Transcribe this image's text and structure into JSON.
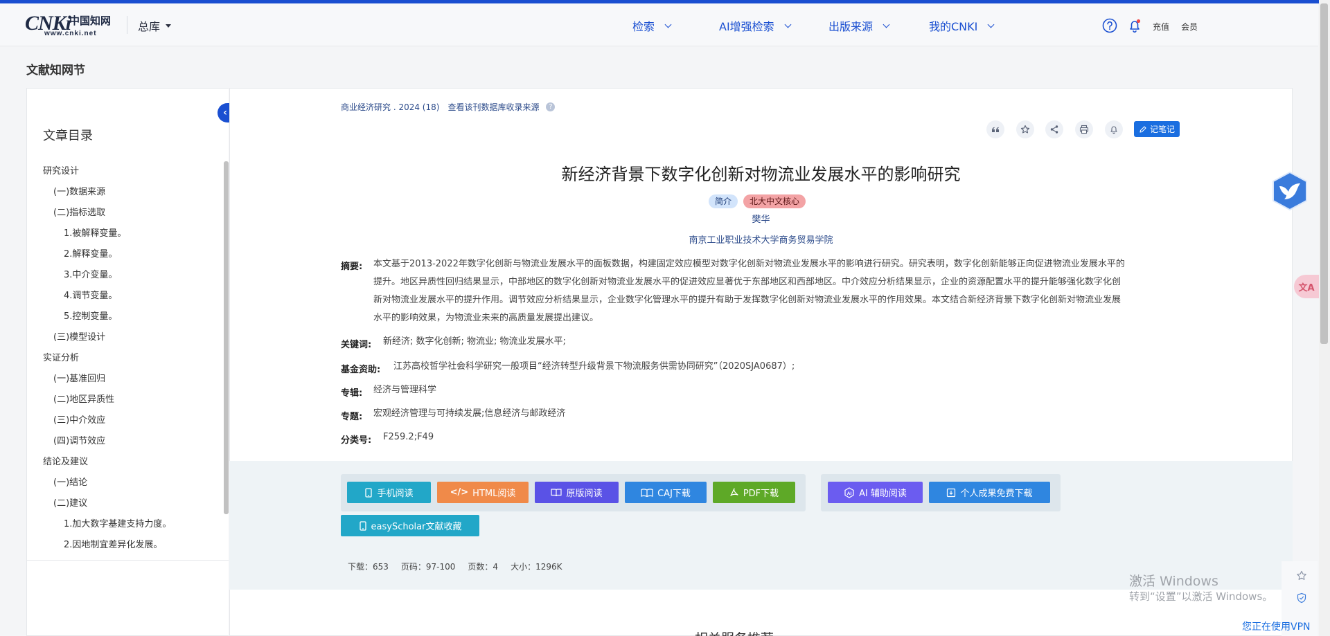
{
  "header": {
    "logo_mark": "CNKi",
    "logo_cn": "中国知网",
    "logo_url": "www.cnki.net",
    "database": "总库",
    "nav": [
      "检索",
      "AI增强检索",
      "出版来源",
      "我的CNKI"
    ],
    "recharge": "充值",
    "member": "会员"
  },
  "section_title": "文献知网节",
  "toc": {
    "title": "文章目录",
    "items": [
      {
        "text": "研究设计",
        "level": 0
      },
      {
        "text": "(一)数据来源",
        "level": 1
      },
      {
        "text": "(二)指标选取",
        "level": 1
      },
      {
        "text": "1.被解释变量。",
        "level": 2
      },
      {
        "text": "2.解释变量。",
        "level": 2
      },
      {
        "text": "3.中介变量。",
        "level": 2
      },
      {
        "text": "4.调节变量。",
        "level": 2
      },
      {
        "text": "5.控制变量。",
        "level": 2
      },
      {
        "text": "(三)模型设计",
        "level": 1
      },
      {
        "text": "实证分析",
        "level": 0
      },
      {
        "text": "(一)基准回归",
        "level": 1
      },
      {
        "text": "(二)地区异质性",
        "level": 1
      },
      {
        "text": "(三)中介效应",
        "level": 1
      },
      {
        "text": "(四)调节效应",
        "level": 1
      },
      {
        "text": "结论及建议",
        "level": 0
      },
      {
        "text": "(一)结论",
        "level": 1
      },
      {
        "text": "(二)建议",
        "level": 1
      },
      {
        "text": "1.加大数字基建支持力度。",
        "level": 2
      },
      {
        "text": "2.因地制宜差异化发展。",
        "level": 2
      }
    ]
  },
  "article": {
    "source": "商业经济研究 . 2024 (18)",
    "source_link": "查看该刊数据库收录来源",
    "note_button": "记笔记",
    "title": "新经济背景下数字化创新对物流业发展水平的影响研究",
    "badges": [
      "简介",
      "北大中文核心"
    ],
    "author": "樊华",
    "institution": "南京工业职业技术大学商务贸易学院",
    "abstract_label": "摘要:",
    "abstract_lines": [
      "本文基于2013-2022年数字化创新与物流业发展水平的面板数据，构建固定效应模型对数字化创新对物流业发展水平的影响进行研究。研究表明，数字化创新能够正向促进物流业发展水平的",
      "提升。地区异质性回归结果显示，中部地区的数字化创新对物流业发展水平的促进效应显著优于东部地区和西部地区。中介效应分析结果显示，企业的资源配置水平的提升能够强化数字化创",
      "新对物流业发展水平的提升作用。调节效应分析结果显示，企业数字化管理水平的提升有助于发挥数字化创新对物流业发展水平的作用效果。本文结合新经济背景下数字化创新对物流业发展",
      "水平的影响效果，为物流业未来的高质量发展提出建议。"
    ],
    "keywords_label": "关键词:",
    "keywords": "新经济;  数字化创新;  物流业;  物流业发展水平;",
    "fund_label": "基金资助:",
    "fund": "江苏高校哲学社会科学研究一般项目“经济转型升级背景下物流服务供需协同研究”（2020SJA0687）;",
    "album_label": "专辑:",
    "album": "经济与管理科学",
    "topic_label": "专题:",
    "topic": "宏观经济管理与可持续发展;信息经济与邮政经济",
    "class_label": "分类号:",
    "class": "F259.2;F49"
  },
  "actions": {
    "mobile": "手机阅读",
    "html": "HTML阅读",
    "original": "原版阅读",
    "caj": "CAJ下载",
    "pdf": "PDF下载",
    "ai": "AI 辅助阅读",
    "personal": "个人成果免费下载",
    "easyscholar": "easyScholar文献收藏"
  },
  "stats": {
    "downloads": "下载：653",
    "pages": "页码：97-100",
    "page_count": "页数：4",
    "size": "大小：1296K"
  },
  "colors": {
    "mobile": "#22a7c8",
    "html": "#f08a49",
    "original": "#5a52e6",
    "caj": "#2f86e0",
    "pdf": "#5ea927",
    "ai": "#6b5cf0",
    "personal": "#2f86e0",
    "easyscholar": "#22a7c8"
  },
  "overlay": {
    "win_title": "激活 Windows",
    "win_sub": "转到“设置”以激活 Windows。",
    "vpn": "您正在使用VPN",
    "recommend": "相关服务推荐"
  }
}
